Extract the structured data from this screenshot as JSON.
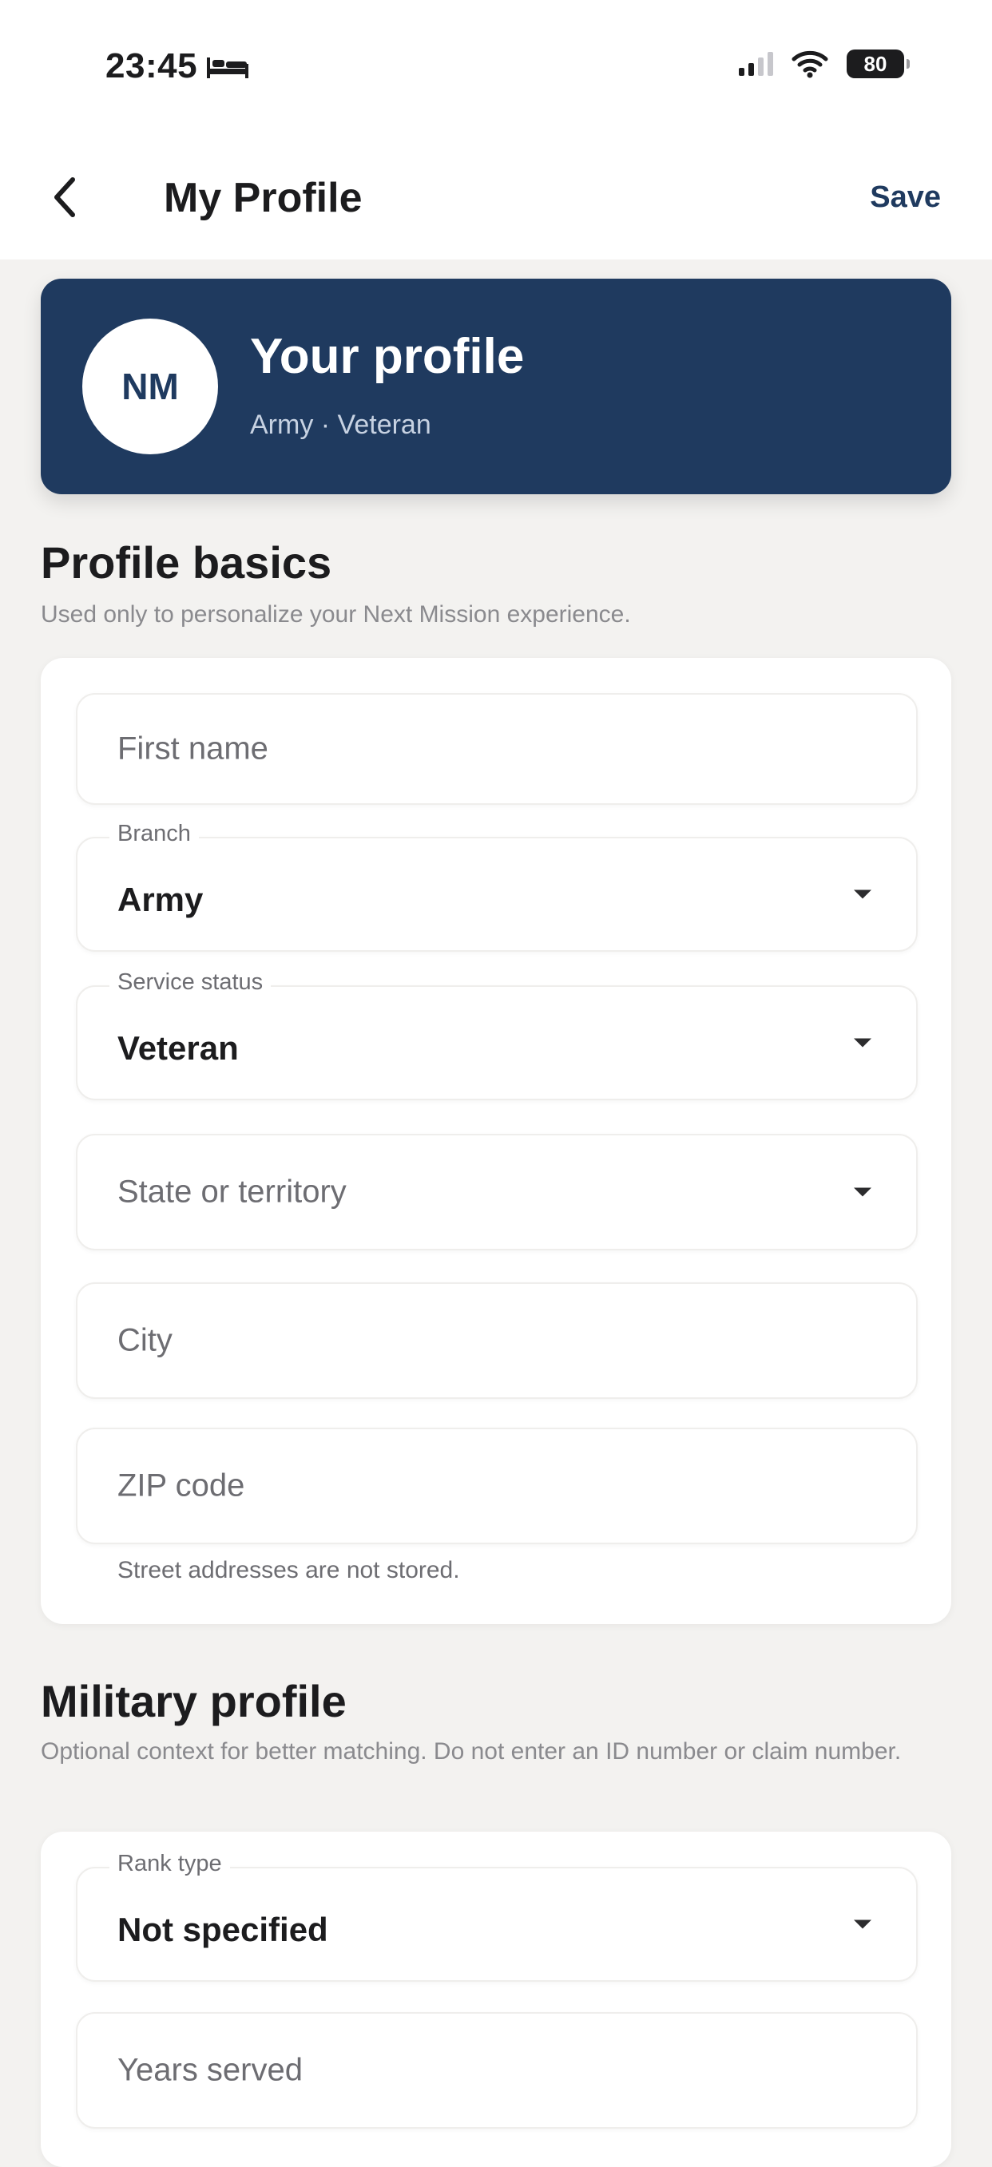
{
  "status_bar": {
    "time": "23:45",
    "battery": "80"
  },
  "nav": {
    "title": "My Profile",
    "save_label": "Save"
  },
  "hero": {
    "initials": "NM",
    "title": "Your profile",
    "subtitle": "Army · Veteran"
  },
  "profile_basics": {
    "title": "Profile basics",
    "description": "Used only to personalize your Next Mission experience.",
    "fields": {
      "first_name": {
        "placeholder": "First name"
      },
      "branch": {
        "label": "Branch",
        "value": "Army"
      },
      "service_status": {
        "label": "Service status",
        "value": "Veteran"
      },
      "state": {
        "placeholder": "State or territory"
      },
      "city": {
        "placeholder": "City"
      },
      "zip": {
        "placeholder": "ZIP code"
      }
    },
    "note": "Street addresses are not stored."
  },
  "military_profile": {
    "title": "Military profile",
    "description": "Optional context for better matching. Do not enter an ID number or claim number.",
    "fields": {
      "rank_type": {
        "label": "Rank type",
        "value": "Not specified"
      },
      "years_served": {
        "placeholder": "Years served"
      }
    }
  },
  "colors": {
    "accent": "#1f3a5f",
    "background": "#f3f2f0",
    "card": "#ffffff"
  }
}
